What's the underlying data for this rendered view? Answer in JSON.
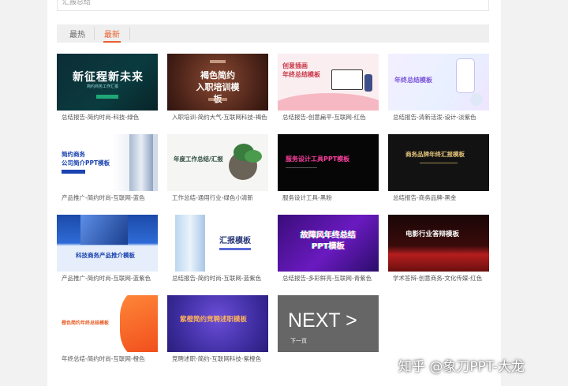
{
  "top_text": "汇报总结",
  "tabs": {
    "hot": "最热",
    "new": "最新"
  },
  "cards": [
    {
      "title": "新征程新未来",
      "subtitle": "简约商务工作汇报",
      "caption": "总结报告-简约时尚-科技-绿色"
    },
    {
      "title": "褐色简约\n入职培训模板",
      "subtitle": "",
      "caption": "入职培训-简约大气-互联网科技-褐色"
    },
    {
      "title": "创意插画\n年终总结模板",
      "subtitle": "",
      "caption": "总结报告-创意扁平-互联网-红色"
    },
    {
      "title": "年终总结模板",
      "subtitle": "",
      "caption": "总结报告-清新活泼-设计-淡紫色"
    },
    {
      "title": "简约商务\n公司简介PPT模板",
      "subtitle": "",
      "caption": "产品推广-简约时尚-互联网-蓝色"
    },
    {
      "title": "年度工作总结/汇报",
      "subtitle": "",
      "caption": "工作总结-通用行业-绿色小清新"
    },
    {
      "title": "服务设计工具PPT模板",
      "subtitle": "",
      "caption": "服务设计工具-黑粉"
    },
    {
      "title": "商务品牌年终汇报模板",
      "subtitle": "",
      "caption": "总结报告-商务品牌-黑金"
    },
    {
      "title": "科技商务产品推介模板",
      "subtitle": "",
      "caption": "产品推广-简约时尚-互联网-蓝紫色"
    },
    {
      "title": "汇报模板",
      "subtitle": "",
      "caption": "总结报告-简约时尚-互联网-蓝紫色"
    },
    {
      "title": "故障风年终总结\nPPT模板",
      "subtitle": "",
      "caption": "总结报告-多彩鲜亮-互联网-青紫色"
    },
    {
      "title": "电影行业答辩模板",
      "subtitle": "",
      "caption": "学术答辩-创意商务-文化传媒-红色"
    },
    {
      "title": "橙色简约年终总结模板",
      "subtitle": "",
      "caption": "年终总结-简约时尚-互联网-橙色"
    },
    {
      "title": "紫橙简约竞聘述职模板",
      "subtitle": "",
      "caption": "竞聘述职-简约-互联网科技-紫橙色"
    }
  ],
  "next": {
    "label": "NEXT >",
    "sub": "下一页"
  },
  "watermark": "知乎 @象刀PPT-大龙"
}
